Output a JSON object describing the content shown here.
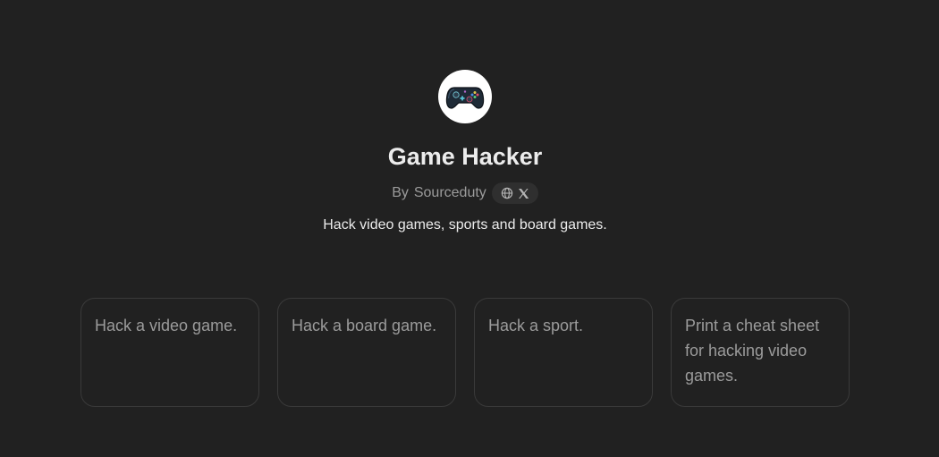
{
  "gpt": {
    "name": "Game Hacker",
    "byline_prefix": "By",
    "author": "Sourceduty",
    "description": "Hack video games, sports and board games.",
    "avatar_icon": "game-controller-icon"
  },
  "social": {
    "icons": [
      "globe-icon",
      "x-logo-icon"
    ]
  },
  "starters": [
    {
      "label": "Hack a video game."
    },
    {
      "label": "Hack a board game."
    },
    {
      "label": "Hack a sport."
    },
    {
      "label": "Print a cheat sheet for hacking video games."
    }
  ],
  "colors": {
    "background": "#212121",
    "card_border": "#3a3a3a",
    "text_primary": "#ececec",
    "text_muted": "#9b9b9b"
  }
}
